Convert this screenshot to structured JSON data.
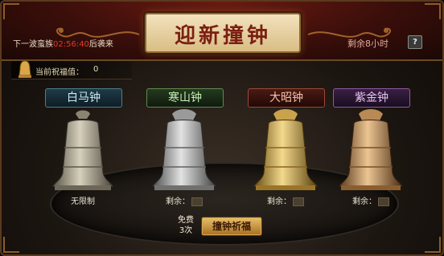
{
  "header": {
    "title": "迎新撞钟",
    "wave_prefix": "下一波蛮族",
    "wave_time": "02:56:40",
    "wave_suffix": "后袭来",
    "remaining": "剩余8小时",
    "help": "?"
  },
  "blessing": {
    "label": "当前祝福值：",
    "value": "0"
  },
  "bells": [
    {
      "name": "白马钟",
      "count_text": "无限制",
      "color": "#b9b3a1"
    },
    {
      "name": "寒山钟",
      "count_label": "剩余：",
      "color": "#c9c9c9"
    },
    {
      "name": "大昭钟",
      "count_label": "剩余：",
      "color": "#d8b45a"
    },
    {
      "name": "紫金钟",
      "count_label": "剩余：",
      "color": "#d0a36a"
    }
  ],
  "actions": {
    "free_line1": "免费",
    "free_line2": "3次",
    "ring_button": "撞钟祈福"
  },
  "colors": {
    "title_red": "#7a1f12",
    "wave_time_red": "#e03a2d",
    "gold": "#e7c06a"
  }
}
